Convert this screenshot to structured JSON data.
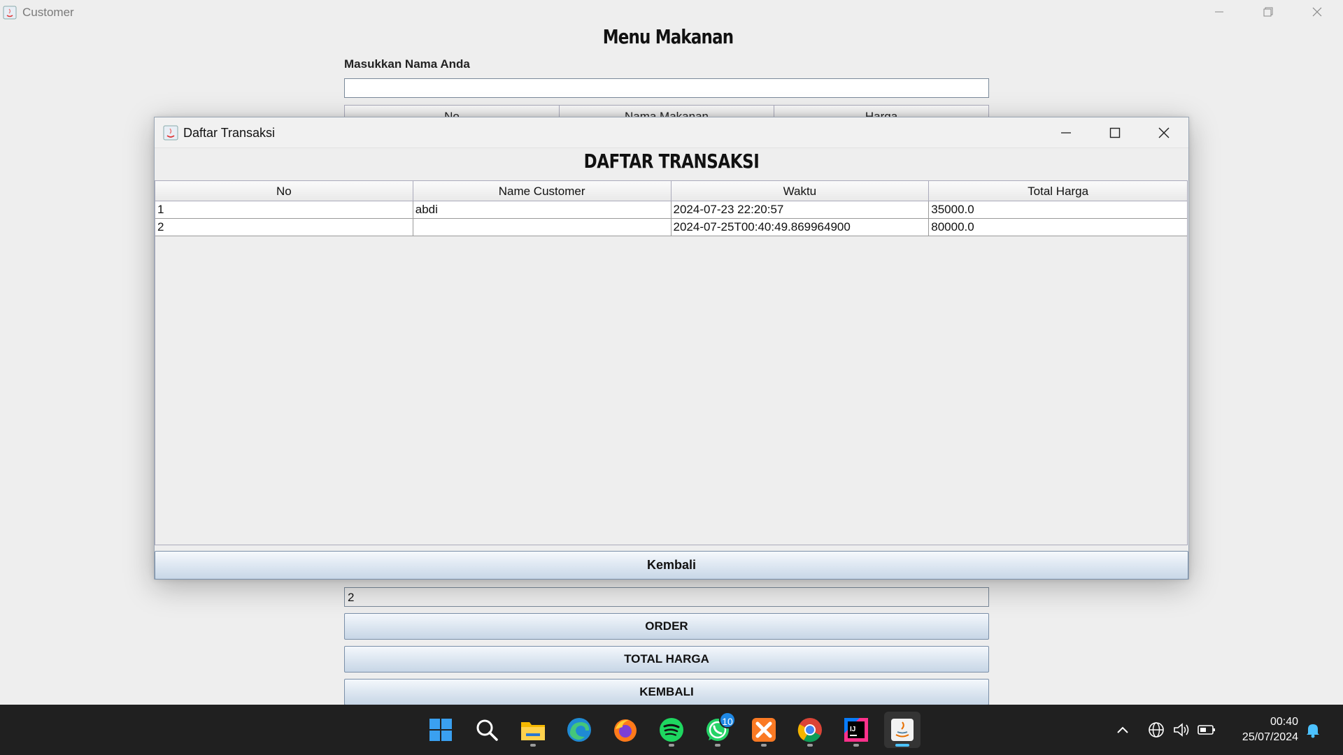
{
  "customer_window": {
    "title": "Customer",
    "heading": "Menu Makanan",
    "name_label": "Masukkan Nama Anda",
    "name_value": "",
    "menu_table_headers": [
      "No",
      "Nama Makanan",
      "Harga"
    ],
    "qty_value": "2",
    "buttons": {
      "order": "ORDER",
      "total": "TOTAL HARGA",
      "kembali": "KEMBALI"
    }
  },
  "dialog": {
    "title": "Daftar Transaksi",
    "heading": "DAFTAR TRANSAKSI",
    "columns": [
      "No",
      "Name Customer",
      "Waktu",
      "Total Harga"
    ],
    "rows": [
      [
        "1",
        "abdi",
        "2024-07-23 22:20:57",
        "35000.0"
      ],
      [
        "2",
        "",
        "2024-07-25T00:40:49.869964900",
        "80000.0"
      ]
    ],
    "kembali_label": "Kembali"
  },
  "taskbar": {
    "apps": [
      {
        "name": "start-icon"
      },
      {
        "name": "search-icon"
      },
      {
        "name": "file-explorer-icon"
      },
      {
        "name": "edge-icon"
      },
      {
        "name": "firefox-icon"
      },
      {
        "name": "spotify-icon"
      },
      {
        "name": "whatsapp-icon",
        "badge": "10"
      },
      {
        "name": "xampp-icon"
      },
      {
        "name": "chrome-icon"
      },
      {
        "name": "intellij-icon"
      },
      {
        "name": "java-icon"
      }
    ],
    "time": "00:40",
    "date": "25/07/2024"
  },
  "colors": {
    "button_gradient_top": "#f4f8fc",
    "button_gradient_bottom": "#c7d6e6",
    "taskbar": "#202020",
    "accent": "#4cc2ff"
  }
}
